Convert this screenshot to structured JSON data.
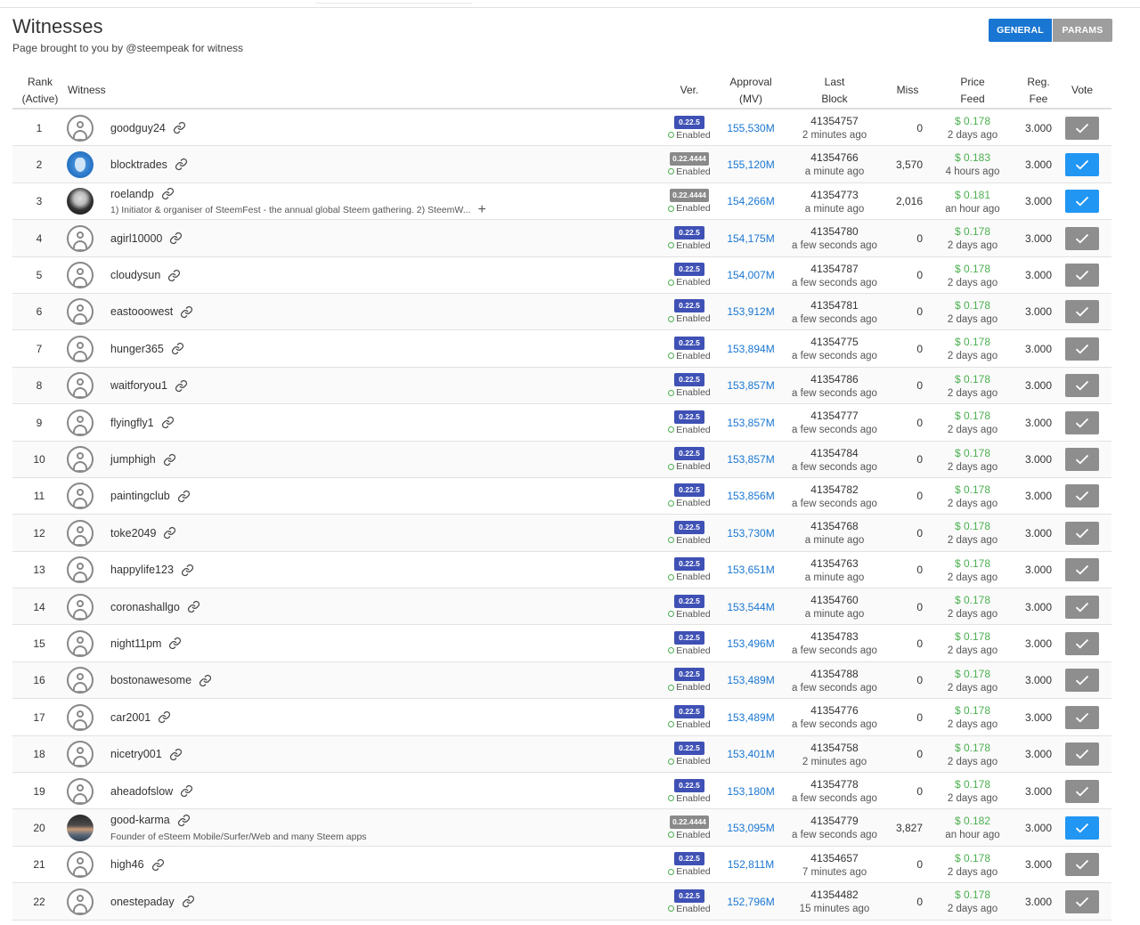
{
  "page": {
    "title": "Witnesses",
    "subtitle": "Page brought to you by @steempeak for witness"
  },
  "tabs": [
    {
      "label": "GENERAL",
      "active": true
    },
    {
      "label": "PARAMS",
      "active": false
    }
  ],
  "colors": {
    "accent": "#1976d2",
    "version_badge": "#3f51b5",
    "enabled": "#4caf50",
    "price": "#4caf50",
    "vote_on": "#2196f3",
    "vote_off": "#8e8e8e"
  },
  "columns": {
    "rank": "Rank\n(Active)",
    "witness": "Witness",
    "ver": "Ver.",
    "approval": "Approval\n(MV)",
    "last_block": "Last\nBlock",
    "miss": "Miss",
    "price_feed": "Price\nFeed",
    "reg_fee": "Reg.\nFee",
    "vote": "Vote"
  },
  "rows": [
    {
      "rank": "1",
      "name": "goodguy24",
      "avatar": "default",
      "desc": "",
      "ver": "0.22.5",
      "status": "Enabled",
      "approval": "155,530M",
      "block": "41354757",
      "block_ago": "2 minutes ago",
      "miss": "0",
      "price": "$ 0.178",
      "price_ago": "2 days ago",
      "fee": "3.000",
      "voted": false
    },
    {
      "rank": "2",
      "name": "blocktrades",
      "avatar": "blue",
      "desc": "",
      "ver": "0.22.4444",
      "status": "Enabled",
      "approval": "155,120M",
      "block": "41354766",
      "block_ago": "a minute ago",
      "miss": "3,570",
      "price": "$ 0.183",
      "price_ago": "4 hours ago",
      "fee": "3.000",
      "voted": true
    },
    {
      "rank": "3",
      "name": "roelandp",
      "avatar": "dark",
      "desc": "1) Initiator & organiser of SteemFest - the annual global Steem gathering. 2) SteemW...",
      "ver": "0.22.4444",
      "status": "Enabled",
      "approval": "154,266M",
      "block": "41354773",
      "block_ago": "a minute ago",
      "miss": "2,016",
      "price": "$ 0.181",
      "price_ago": "an hour ago",
      "fee": "3.000",
      "voted": true
    },
    {
      "rank": "4",
      "name": "agirl10000",
      "avatar": "default",
      "desc": "",
      "ver": "0.22.5",
      "status": "Enabled",
      "approval": "154,175M",
      "block": "41354780",
      "block_ago": "a few seconds ago",
      "miss": "0",
      "price": "$ 0.178",
      "price_ago": "2 days ago",
      "fee": "3.000",
      "voted": false
    },
    {
      "rank": "5",
      "name": "cloudysun",
      "avatar": "default",
      "desc": "",
      "ver": "0.22.5",
      "status": "Enabled",
      "approval": "154,007M",
      "block": "41354787",
      "block_ago": "a few seconds ago",
      "miss": "0",
      "price": "$ 0.178",
      "price_ago": "2 days ago",
      "fee": "3.000",
      "voted": false
    },
    {
      "rank": "6",
      "name": "eastooowest",
      "avatar": "default",
      "desc": "",
      "ver": "0.22.5",
      "status": "Enabled",
      "approval": "153,912M",
      "block": "41354781",
      "block_ago": "a few seconds ago",
      "miss": "0",
      "price": "$ 0.178",
      "price_ago": "2 days ago",
      "fee": "3.000",
      "voted": false
    },
    {
      "rank": "7",
      "name": "hunger365",
      "avatar": "default",
      "desc": "",
      "ver": "0.22.5",
      "status": "Enabled",
      "approval": "153,894M",
      "block": "41354775",
      "block_ago": "a few seconds ago",
      "miss": "0",
      "price": "$ 0.178",
      "price_ago": "2 days ago",
      "fee": "3.000",
      "voted": false
    },
    {
      "rank": "8",
      "name": "waitforyou1",
      "avatar": "default",
      "desc": "",
      "ver": "0.22.5",
      "status": "Enabled",
      "approval": "153,857M",
      "block": "41354786",
      "block_ago": "a few seconds ago",
      "miss": "0",
      "price": "$ 0.178",
      "price_ago": "2 days ago",
      "fee": "3.000",
      "voted": false
    },
    {
      "rank": "9",
      "name": "flyingfly1",
      "avatar": "default",
      "desc": "",
      "ver": "0.22.5",
      "status": "Enabled",
      "approval": "153,857M",
      "block": "41354777",
      "block_ago": "a few seconds ago",
      "miss": "0",
      "price": "$ 0.178",
      "price_ago": "2 days ago",
      "fee": "3.000",
      "voted": false
    },
    {
      "rank": "10",
      "name": "jumphigh",
      "avatar": "default",
      "desc": "",
      "ver": "0.22.5",
      "status": "Enabled",
      "approval": "153,857M",
      "block": "41354784",
      "block_ago": "a few seconds ago",
      "miss": "0",
      "price": "$ 0.178",
      "price_ago": "2 days ago",
      "fee": "3.000",
      "voted": false
    },
    {
      "rank": "11",
      "name": "paintingclub",
      "avatar": "default",
      "desc": "",
      "ver": "0.22.5",
      "status": "Enabled",
      "approval": "153,856M",
      "block": "41354782",
      "block_ago": "a few seconds ago",
      "miss": "0",
      "price": "$ 0.178",
      "price_ago": "2 days ago",
      "fee": "3.000",
      "voted": false
    },
    {
      "rank": "12",
      "name": "toke2049",
      "avatar": "default",
      "desc": "",
      "ver": "0.22.5",
      "status": "Enabled",
      "approval": "153,730M",
      "block": "41354768",
      "block_ago": "a minute ago",
      "miss": "0",
      "price": "$ 0.178",
      "price_ago": "2 days ago",
      "fee": "3.000",
      "voted": false
    },
    {
      "rank": "13",
      "name": "happylife123",
      "avatar": "default",
      "desc": "",
      "ver": "0.22.5",
      "status": "Enabled",
      "approval": "153,651M",
      "block": "41354763",
      "block_ago": "a minute ago",
      "miss": "0",
      "price": "$ 0.178",
      "price_ago": "2 days ago",
      "fee": "3.000",
      "voted": false
    },
    {
      "rank": "14",
      "name": "coronashallgo",
      "avatar": "default",
      "desc": "",
      "ver": "0.22.5",
      "status": "Enabled",
      "approval": "153,544M",
      "block": "41354760",
      "block_ago": "a minute ago",
      "miss": "0",
      "price": "$ 0.178",
      "price_ago": "2 days ago",
      "fee": "3.000",
      "voted": false
    },
    {
      "rank": "15",
      "name": "night11pm",
      "avatar": "default",
      "desc": "",
      "ver": "0.22.5",
      "status": "Enabled",
      "approval": "153,496M",
      "block": "41354783",
      "block_ago": "a few seconds ago",
      "miss": "0",
      "price": "$ 0.178",
      "price_ago": "2 days ago",
      "fee": "3.000",
      "voted": false
    },
    {
      "rank": "16",
      "name": "bostonawesome",
      "avatar": "default",
      "desc": "",
      "ver": "0.22.5",
      "status": "Enabled",
      "approval": "153,489M",
      "block": "41354788",
      "block_ago": "a few seconds ago",
      "miss": "0",
      "price": "$ 0.178",
      "price_ago": "2 days ago",
      "fee": "3.000",
      "voted": false
    },
    {
      "rank": "17",
      "name": "car2001",
      "avatar": "default",
      "desc": "",
      "ver": "0.22.5",
      "status": "Enabled",
      "approval": "153,489M",
      "block": "41354776",
      "block_ago": "a few seconds ago",
      "miss": "0",
      "price": "$ 0.178",
      "price_ago": "2 days ago",
      "fee": "3.000",
      "voted": false
    },
    {
      "rank": "18",
      "name": "nicetry001",
      "avatar": "default",
      "desc": "",
      "ver": "0.22.5",
      "status": "Enabled",
      "approval": "153,401M",
      "block": "41354758",
      "block_ago": "2 minutes ago",
      "miss": "0",
      "price": "$ 0.178",
      "price_ago": "2 days ago",
      "fee": "3.000",
      "voted": false
    },
    {
      "rank": "19",
      "name": "aheadofslow",
      "avatar": "default",
      "desc": "",
      "ver": "0.22.5",
      "status": "Enabled",
      "approval": "153,180M",
      "block": "41354778",
      "block_ago": "a few seconds ago",
      "miss": "0",
      "price": "$ 0.178",
      "price_ago": "2 days ago",
      "fee": "3.000",
      "voted": false
    },
    {
      "rank": "20",
      "name": "good-karma",
      "avatar": "photo",
      "desc": "Founder of eSteem Mobile/Surfer/Web and many Steem apps",
      "ver": "0.22.4444",
      "status": "Enabled",
      "approval": "153,095M",
      "block": "41354779",
      "block_ago": "a few seconds ago",
      "miss": "3,827",
      "price": "$ 0.182",
      "price_ago": "an hour ago",
      "fee": "3.000",
      "voted": true
    },
    {
      "rank": "21",
      "name": "high46",
      "avatar": "default",
      "desc": "",
      "ver": "0.22.5",
      "status": "Enabled",
      "approval": "152,811M",
      "block": "41354657",
      "block_ago": "7 minutes ago",
      "miss": "0",
      "price": "$ 0.178",
      "price_ago": "2 days ago",
      "fee": "3.000",
      "voted": false
    },
    {
      "rank": "22",
      "name": "onestepaday",
      "avatar": "default",
      "desc": "",
      "ver": "0.22.5",
      "status": "Enabled",
      "approval": "152,796M",
      "block": "41354482",
      "block_ago": "15 minutes ago",
      "miss": "0",
      "price": "$ 0.178",
      "price_ago": "2 days ago",
      "fee": "3.000",
      "voted": false
    }
  ]
}
